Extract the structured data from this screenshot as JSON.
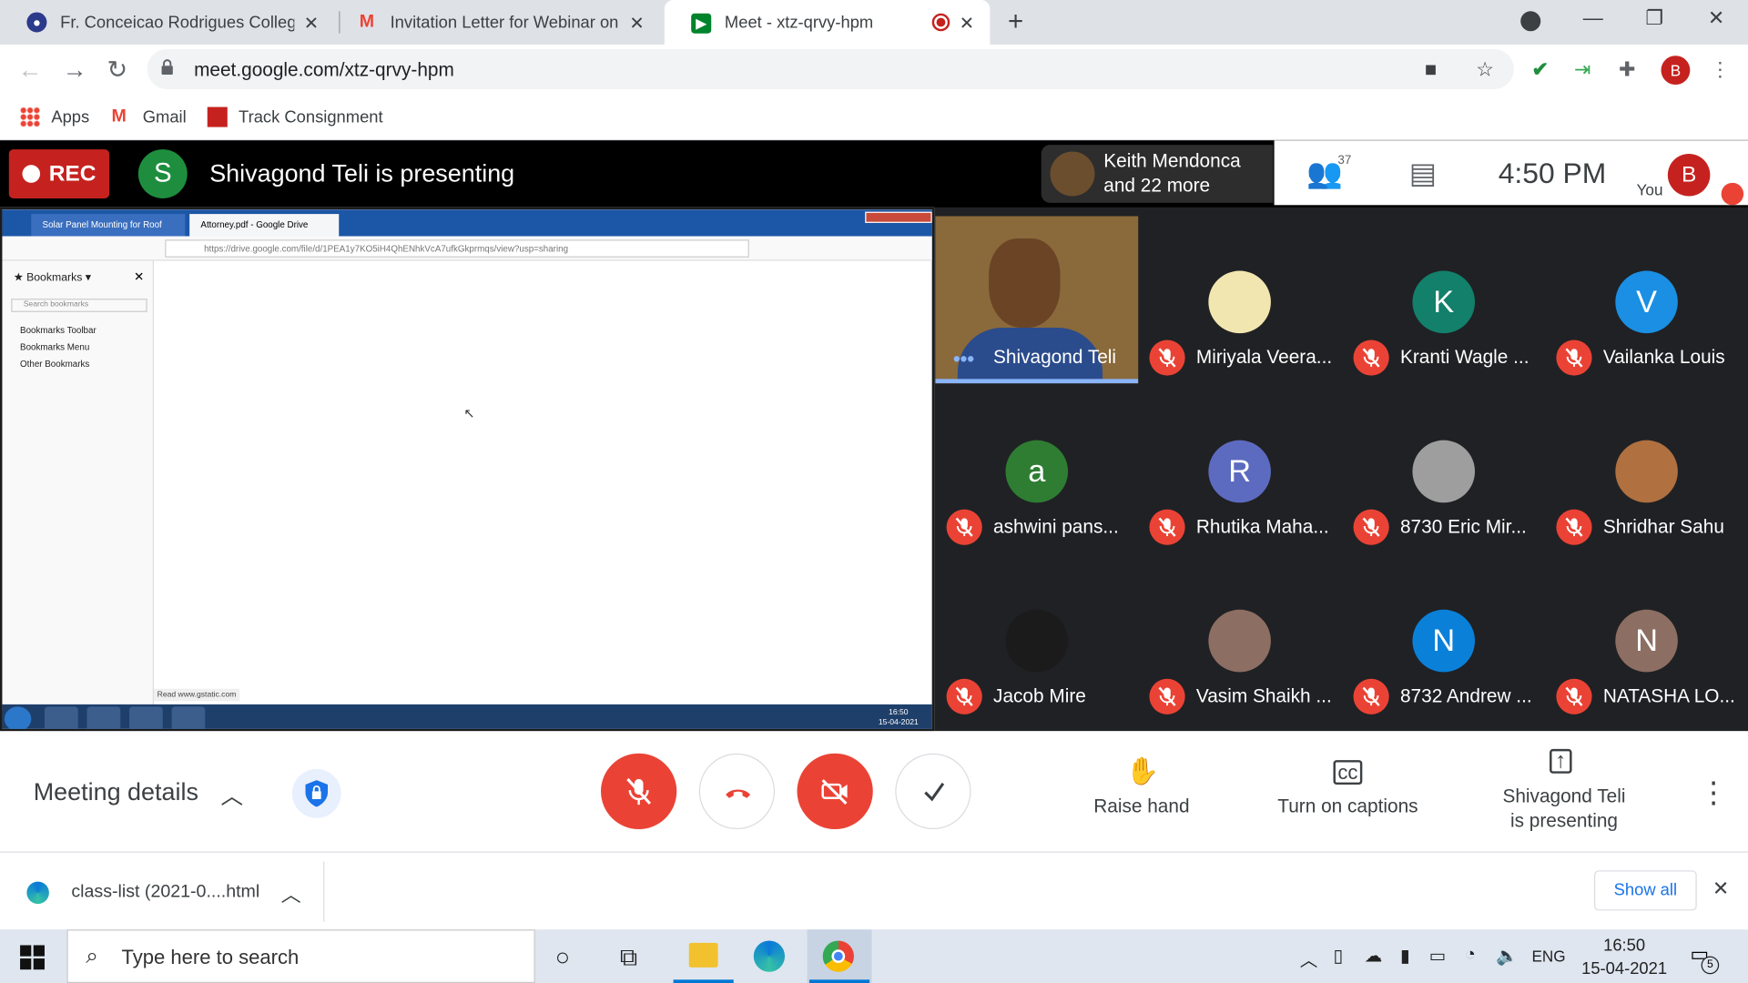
{
  "browser": {
    "tabs": [
      {
        "title": "Fr. Conceicao Rodrigues College",
        "favicon_color": "#2b3a8a"
      },
      {
        "title": "Invitation Letter for Webinar on",
        "favicon_color": "#ea4335"
      },
      {
        "title": "Meet - xtz-qrvy-hpm",
        "favicon_color": "#00832d",
        "active": true,
        "recording": true
      }
    ],
    "url": "meet.google.com/xtz-qrvy-hpm",
    "profile_initial": "B",
    "bookmarks": [
      "Apps",
      "Gmail",
      "Track Consignment"
    ]
  },
  "meet": {
    "rec_label": "REC",
    "presenter_initial": "S",
    "presenting_text": "Shivagond Teli is presenting",
    "top_participants": "Keith Mendonca and 22 more",
    "participants_count": "37",
    "time": "4:50 PM",
    "you_label": "You",
    "you_initial": "B",
    "shared_screen": {
      "tab1": "Solar Panel Mounting for Roof",
      "tab2": "Attorney.pdf - Google Drive",
      "url": "https://drive.google.com/file/d/1PEA1y7KO5iH4QhENhkVcA7ufkGkprmqs/view?usp=sharing",
      "bookmarks_header": "Bookmarks",
      "search_placeholder": "Search bookmarks",
      "bookmark_items": [
        "Bookmarks Toolbar",
        "Bookmarks Menu",
        "Other Bookmarks"
      ],
      "status": "Read www.gstatic.com",
      "clock_time": "16:50",
      "clock_date": "15-04-2021"
    },
    "tiles": [
      {
        "name": "Shivagond Teli",
        "type": "video"
      },
      {
        "name": "Miriyala Veera...",
        "initial": "",
        "color": "#f2e6b0"
      },
      {
        "name": "Kranti Wagle ...",
        "initial": "K",
        "color": "#12806a"
      },
      {
        "name": "Vailanka Louis",
        "initial": "V",
        "color": "#1a8fe3"
      },
      {
        "name": "ashwini pans...",
        "initial": "a",
        "color": "#2e7d32"
      },
      {
        "name": "Rhutika Maha...",
        "initial": "R",
        "color": "#5c6bc0"
      },
      {
        "name": "8730 Eric Mir...",
        "initial": "",
        "color": "#9e9e9e"
      },
      {
        "name": "Shridhar Sahu",
        "initial": "",
        "color": "#b07040"
      },
      {
        "name": "Jacob Mire",
        "initial": "",
        "color": "#1b1b1b"
      },
      {
        "name": "Vasim Shaikh ...",
        "initial": "",
        "color": "#8d6e63"
      },
      {
        "name": "8732 Andrew ...",
        "initial": "N",
        "color": "#0a80d8"
      },
      {
        "name": "NATASHA LO...",
        "initial": "N",
        "color": "#8d6e63"
      }
    ]
  },
  "controls": {
    "meeting_details": "Meeting details",
    "raise_hand": "Raise hand",
    "captions": "Turn on captions",
    "presenting_line1": "Shivagond Teli",
    "presenting_line2": "is presenting"
  },
  "download": {
    "filename": "class-list (2021-0....html",
    "show_all": "Show all"
  },
  "taskbar": {
    "search_placeholder": "Type here to search",
    "language": "ENG",
    "time": "16:50",
    "date": "15-04-2021",
    "notification_count": "5"
  }
}
